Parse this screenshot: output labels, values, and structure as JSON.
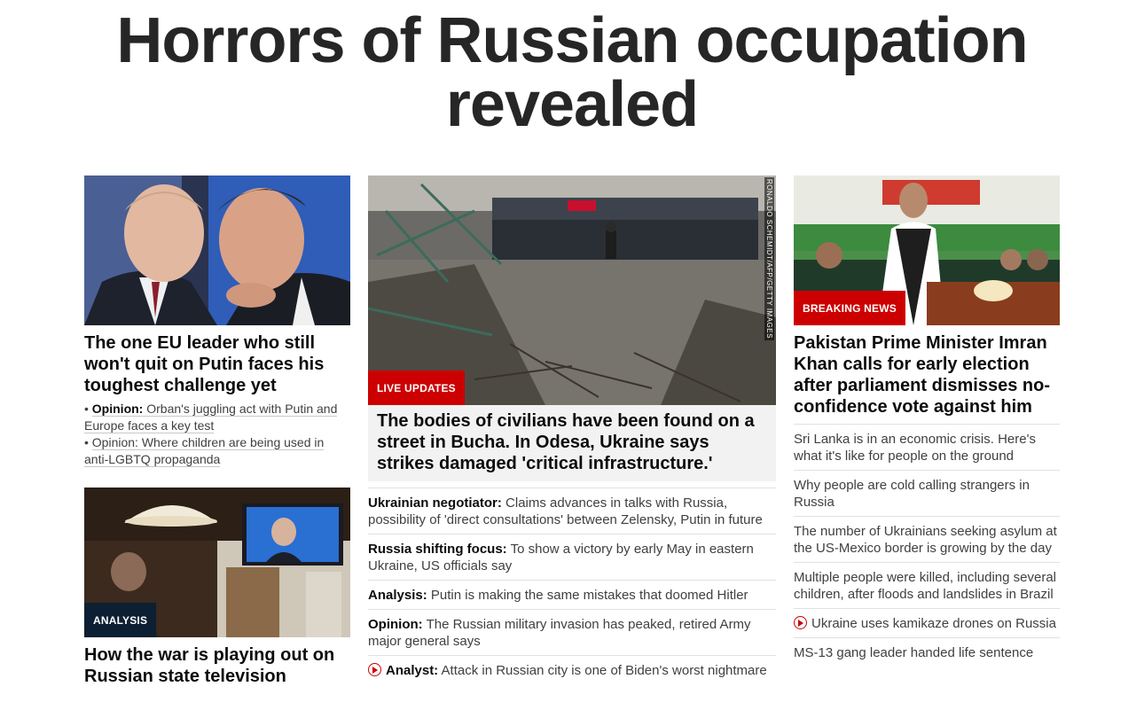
{
  "headline": "Horrors of Russian occupation revealed",
  "left": {
    "card1": {
      "title": "The one EU leader who still won't quit on Putin faces his toughest challenge yet",
      "sublinks": [
        {
          "prefix": "Opinion:",
          "text": "Orban's juggling act with Putin and Europe faces a key test"
        },
        {
          "prefix": "",
          "text": "Opinion: Where children are being used in anti-LGBTQ propaganda"
        }
      ]
    },
    "card2": {
      "badge": "ANALYSIS",
      "title": "How the war is playing out on Russian state television"
    }
  },
  "middle": {
    "badge": "LIVE UPDATES",
    "credit": "RONALDO SCHEMIDT/AFP/GETTY IMAGES",
    "title": "The bodies of civilians have been found on a street in Bucha. In Odesa, Ukraine says strikes damaged 'critical infrastructure.'",
    "list": [
      {
        "label": "Ukrainian negotiator:",
        "text": "Claims advances in talks with Russia, possibility of 'direct consultations' between Zelensky, Putin in future",
        "video": false
      },
      {
        "label": "Russia shifting focus:",
        "text": "To show a victory by early May in eastern Ukraine, US officials say",
        "video": false
      },
      {
        "label": "Analysis:",
        "text": "Putin is making the same mistakes that doomed Hitler",
        "video": false
      },
      {
        "label": "Opinion:",
        "text": "The Russian military invasion has peaked, retired Army major general says",
        "video": false
      },
      {
        "label": "Analyst:",
        "text": "Attack in Russian city is one of Biden's worst nightmare",
        "video": true
      }
    ]
  },
  "right": {
    "badge": "BREAKING NEWS",
    "title": "Pakistan Prime Minister Imran Khan calls for early election after parliament dismisses no-confidence vote against him",
    "list": [
      {
        "text": "Sri Lanka is in an economic crisis. Here's what it's like for people on the ground",
        "video": false
      },
      {
        "text": "Why people are cold calling strangers in Russia",
        "video": false
      },
      {
        "text": "The number of Ukrainians seeking asylum at the US-Mexico border is growing by the day",
        "video": false
      },
      {
        "text": "Multiple people were killed, including several children, after floods and landslides in Brazil",
        "video": false
      },
      {
        "text": "Ukraine uses kamikaze drones on Russia",
        "video": true
      },
      {
        "text": "MS-13 gang leader handed life sentence",
        "video": false
      }
    ]
  },
  "colors": {
    "accent": "#cc0000",
    "analysis_badge": "#0c1f33",
    "text": "#0c0c0c",
    "muted": "#404040"
  }
}
